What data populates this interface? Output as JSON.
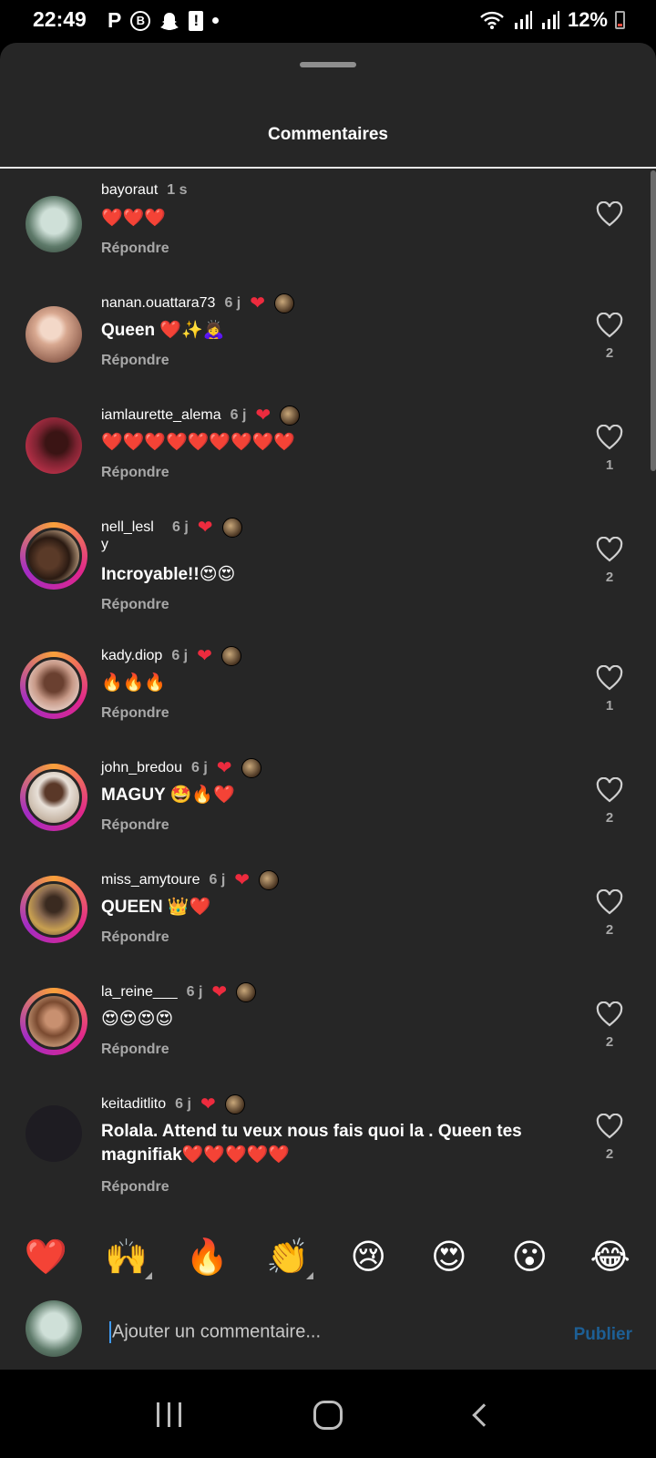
{
  "status_bar": {
    "time": "22:49",
    "left_icons": [
      "parking-icon",
      "bereal-icon",
      "snapchat-icon",
      "alert-icon",
      "dot-icon"
    ],
    "battery": "12%"
  },
  "sheet": {
    "title": "Commentaires"
  },
  "comments": [
    {
      "user": "bayoraut",
      "time": "1 s",
      "creator_liked": false,
      "text": "❤️❤️❤️",
      "reply": "Répondre",
      "likes": ""
    },
    {
      "user": "nanan.ouattara73",
      "time": "6 j",
      "creator_liked": true,
      "text": "Queen ❤️✨🙇‍♀️",
      "reply": "Répondre",
      "likes": "2"
    },
    {
      "user": "iamlaurette_alema",
      "time": "6 j",
      "creator_liked": true,
      "text": "❤️❤️❤️❤️❤️❤️❤️❤️❤️",
      "reply": "Répondre",
      "likes": "1"
    },
    {
      "user": "nell_lesl",
      "user_wrap": "y",
      "time": "6 j",
      "creator_liked": true,
      "text": "Incroyable!!😍😍",
      "reply": "Répondre",
      "likes": "2"
    },
    {
      "user": "kady.diop",
      "time": "6 j",
      "creator_liked": true,
      "text": "🔥🔥🔥",
      "reply": "Répondre",
      "likes": "1"
    },
    {
      "user": "john_bredou",
      "time": "6 j",
      "creator_liked": true,
      "text": "MAGUY 🤩🔥❤️",
      "reply": "Répondre",
      "likes": "2"
    },
    {
      "user": "miss_amytoure",
      "time": "6 j",
      "creator_liked": true,
      "text": "QUEEN 👑❤️",
      "reply": "Répondre",
      "likes": "2"
    },
    {
      "user": "la_reine___",
      "time": "6 j",
      "creator_liked": true,
      "text": "😍😍😍😍",
      "reply": "Répondre",
      "likes": "2"
    },
    {
      "user": "keitaditlito",
      "time": "6 j",
      "creator_liked": true,
      "text": "Rolala. Attend tu veux nous fais quoi la . Queen tes magnifiak❤️❤️❤️❤️❤️",
      "reply": "Répondre",
      "likes": "2"
    }
  ],
  "reactions": [
    "❤️",
    "🙌",
    "🔥",
    "👏",
    "😢",
    "😍",
    "😮",
    "😂"
  ],
  "composer": {
    "placeholder": "Ajouter un commentaire...",
    "publish_label": "Publier"
  },
  "colors": {
    "sheet_bg": "#262626",
    "accent_blue": "#1d5f95",
    "like_red": "#ed2b3e",
    "muted_text": "#a8a8a8"
  }
}
